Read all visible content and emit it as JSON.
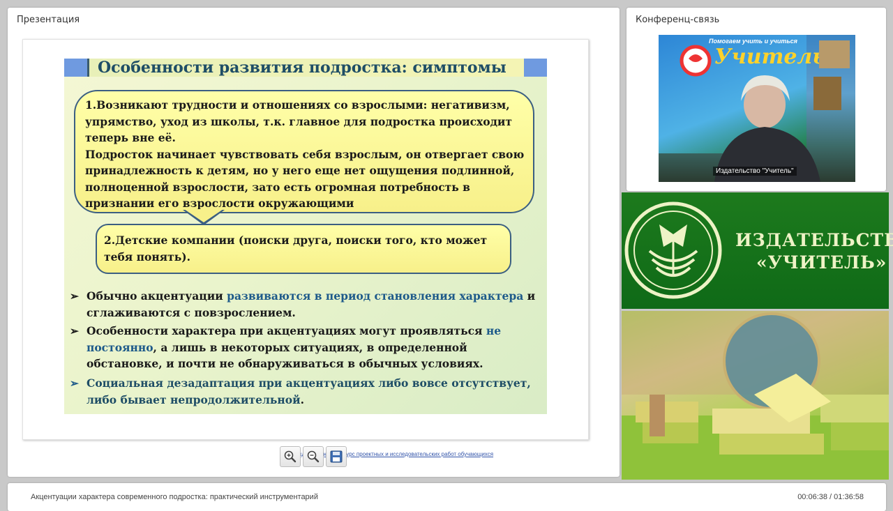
{
  "presentation_panel": {
    "title": "Презентация"
  },
  "slide": {
    "title": "Особенности развития подростка: симптомы",
    "bubble1": {
      "paragraph1": "1.Возникают трудности и отношениях со взрослыми: негативизм, упрямство, уход из школы, т.к. главное для подростка происходит теперь вне её.",
      "paragraph2": "Подросток начинает чувствовать себя взрослым, он отвергает свою принадлежность к детям, но у него еще нет ощущения подлинной, полноценной взрослости, зато есть огромная потребность в признании его взрослости окружающими"
    },
    "bubble2": "2.Детские компании (поиски друга, поиски того, кто может тебя понять).",
    "bullet_mark": "➢",
    "bullets": [
      {
        "pre": "Обычно акцентуации ",
        "highlight": "развиваются в период становления характера",
        "post": " и сглаживаются с повзрослением."
      },
      {
        "pre": "Особенности характера при акцентуациях могут проявляться ",
        "highlight": "не постоянно",
        "post": ", а лишь в некоторых ситуациях, в определенной обстановке, и почти не обнаруживаться в обычных условиях."
      },
      {
        "pre": "Социальная дезадаптация при акцентуациях либо вовсе отсутствует, либо бывает непродолжительной",
        "post": "."
      }
    ],
    "footer_link": "Международный конкурс проектных и исследовательских работ обучающихся"
  },
  "toolbar": {
    "zoom_in_icon": "magnifier-plus-icon",
    "zoom_out_icon": "magnifier-minus-icon",
    "save_icon": "floppy-disk-icon"
  },
  "conference_panel": {
    "title": "Конференц-связь",
    "poster_text_top": "Помогаем учить и учиться",
    "poster_brand": "Учитель",
    "video_name_tag": "Издательство \"Учитель\""
  },
  "brand": {
    "line1": "ИЗДАТЕЛЬСТВО",
    "line2": "«УЧИТЕЛЬ»"
  },
  "bottom_bar": {
    "webinar_title": "Акцентуации характера современного подростка: практический инструментарий",
    "timer": "00:06:38 / 01:36:58"
  },
  "colors": {
    "slide_title": "#1e4d66",
    "highlight": "#1e5a8a",
    "bubble": "#ffffa8",
    "brand_green": "#1d7a1d",
    "header_blue": "#6f9ae0"
  }
}
